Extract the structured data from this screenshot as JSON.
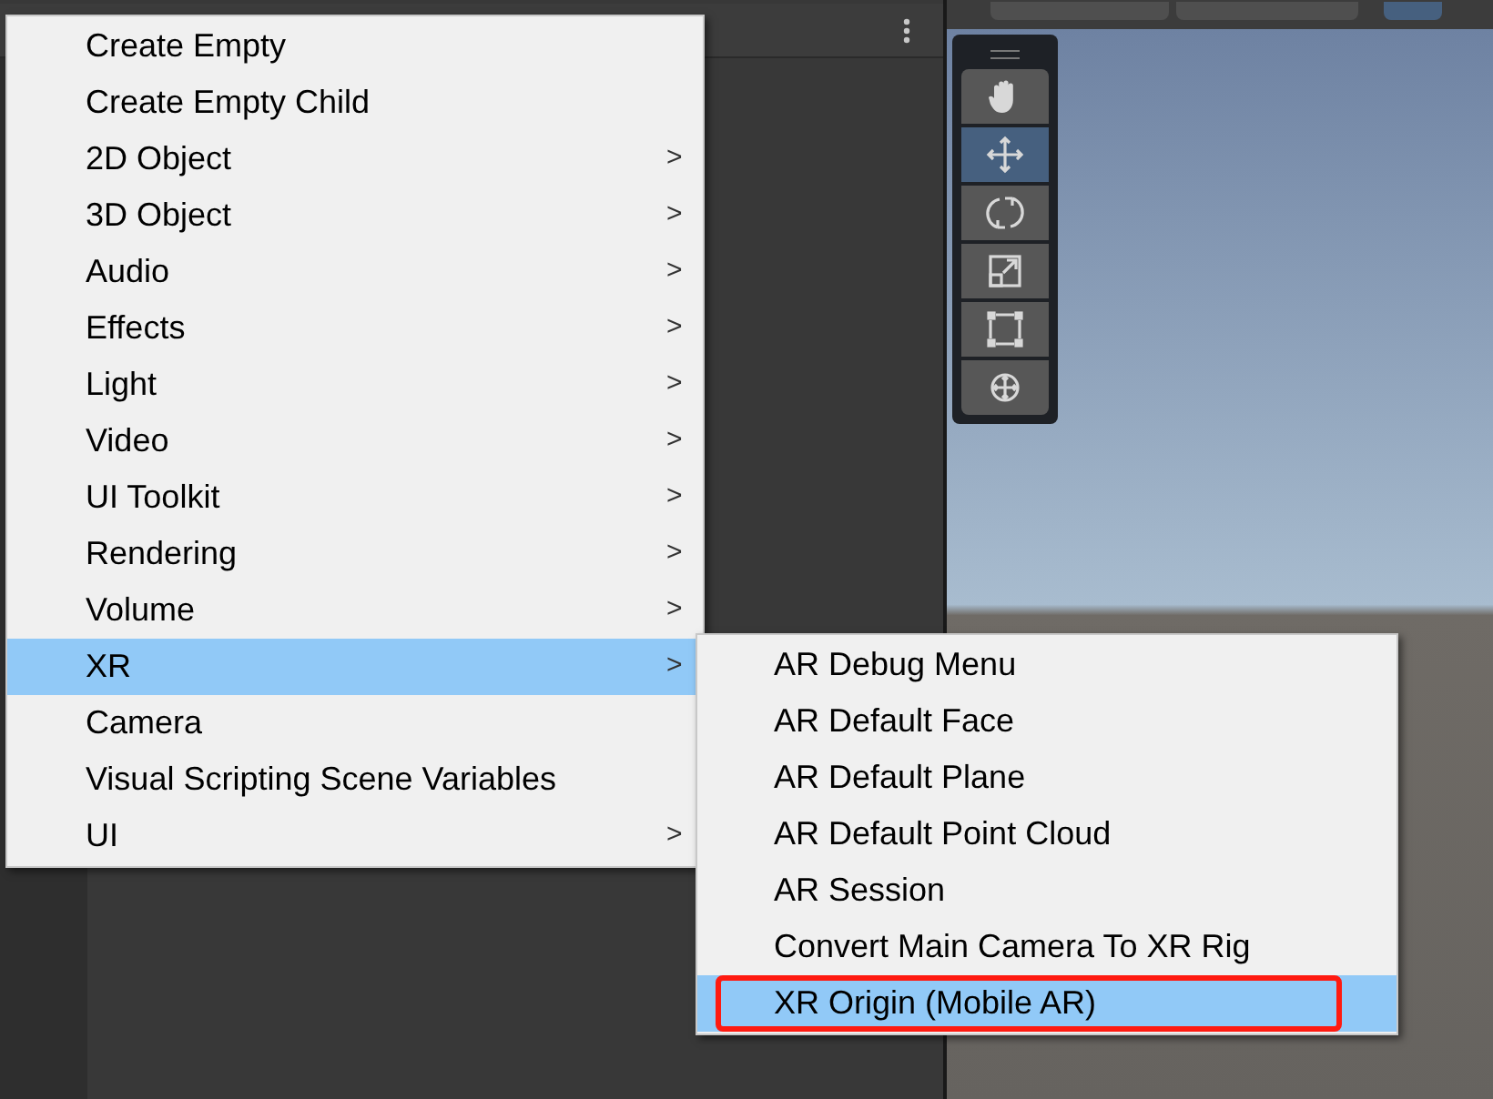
{
  "menu": {
    "items": [
      {
        "label": "Create Empty",
        "submenu": false,
        "selected": false
      },
      {
        "label": "Create Empty Child",
        "submenu": false,
        "selected": false
      },
      {
        "label": "2D Object",
        "submenu": true,
        "selected": false
      },
      {
        "label": "3D Object",
        "submenu": true,
        "selected": false
      },
      {
        "label": "Audio",
        "submenu": true,
        "selected": false
      },
      {
        "label": "Effects",
        "submenu": true,
        "selected": false
      },
      {
        "label": "Light",
        "submenu": true,
        "selected": false
      },
      {
        "label": "Video",
        "submenu": true,
        "selected": false
      },
      {
        "label": "UI Toolkit",
        "submenu": true,
        "selected": false
      },
      {
        "label": "Rendering",
        "submenu": true,
        "selected": false
      },
      {
        "label": "Volume",
        "submenu": true,
        "selected": false
      },
      {
        "label": "XR",
        "submenu": true,
        "selected": true
      },
      {
        "label": "Camera",
        "submenu": false,
        "selected": false
      },
      {
        "label": "Visual Scripting Scene Variables",
        "submenu": false,
        "selected": false
      },
      {
        "label": "UI",
        "submenu": true,
        "selected": false
      }
    ],
    "arrow": ">"
  },
  "submenu": {
    "items": [
      {
        "label": "AR Debug Menu",
        "selected": false,
        "highlighted": false
      },
      {
        "label": "AR Default Face",
        "selected": false,
        "highlighted": false
      },
      {
        "label": "AR Default Plane",
        "selected": false,
        "highlighted": false
      },
      {
        "label": "AR Default Point Cloud",
        "selected": false,
        "highlighted": false
      },
      {
        "label": "AR Session",
        "selected": false,
        "highlighted": false
      },
      {
        "label": "Convert Main Camera To XR Rig",
        "selected": false,
        "highlighted": false
      },
      {
        "label": "XR Origin (Mobile AR)",
        "selected": true,
        "highlighted": true
      }
    ]
  },
  "tools": [
    {
      "kind": "hand",
      "selected": false
    },
    {
      "kind": "move",
      "selected": true
    },
    {
      "kind": "rotate",
      "selected": false
    },
    {
      "kind": "scale",
      "selected": false
    },
    {
      "kind": "rect",
      "selected": false
    },
    {
      "kind": "transform",
      "selected": false
    }
  ]
}
